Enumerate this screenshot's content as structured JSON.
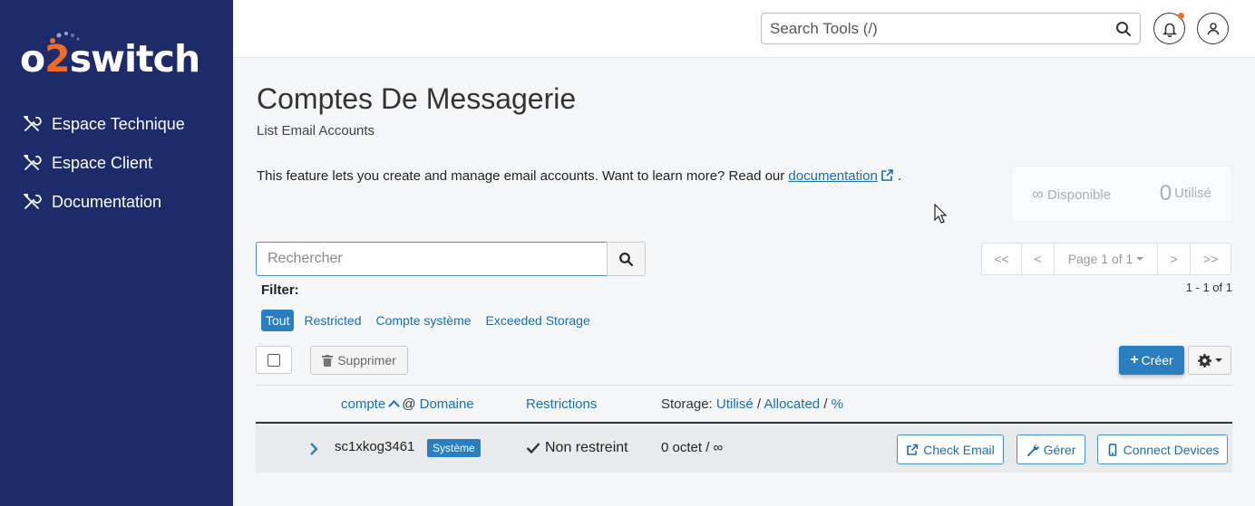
{
  "brand": {
    "logo_prefix": "o",
    "logo_two": "2",
    "logo_suffix": "switch"
  },
  "sidebar": {
    "items": [
      {
        "label": "Espace Technique",
        "icon": "tools-icon"
      },
      {
        "label": "Espace Client",
        "icon": "tools-icon"
      },
      {
        "label": "Documentation",
        "icon": "tools-icon"
      }
    ]
  },
  "topbar": {
    "search_placeholder": "Search Tools (/)",
    "icons": [
      "search-icon",
      "bell-icon",
      "user-icon"
    ]
  },
  "page": {
    "title": "Comptes De Messagerie",
    "subtitle": "List Email Accounts",
    "intro_text": "This feature lets you create and manage email accounts. Want to learn more? Read our ",
    "intro_link": "documentation",
    "intro_end": "."
  },
  "stats": {
    "available_symbol": "∞",
    "available_label": "Disponible",
    "used_value": "0",
    "used_label": "Utilisé"
  },
  "search": {
    "placeholder": "Rechercher"
  },
  "pager": {
    "first": "<<",
    "prev": "<",
    "page_label": "Page 1 of 1",
    "next": ">",
    "last": ">>",
    "range": "1 - 1 of 1"
  },
  "filter": {
    "label": "Filter:",
    "options": [
      "Tout",
      "Restricted",
      "Compte système",
      "Exceeded Storage"
    ],
    "active": "Tout"
  },
  "toolbar": {
    "delete_label": "Supprimer",
    "create_label": "Créer"
  },
  "table": {
    "headers": {
      "account": "compte",
      "at": "@",
      "domain": "Domaine",
      "restrictions": "Restrictions",
      "storage_prefix": "Storage:",
      "used": "Utilisé",
      "sep1": "/",
      "allocated": "Allocated",
      "sep2": "/",
      "percent": "%"
    },
    "rows": [
      {
        "account": "sc1xkog3461",
        "badge": "Système",
        "restriction": "Non restreint",
        "storage": "0 octet / ∞",
        "actions": [
          "Check Email",
          "Gérer",
          "Connect Devices"
        ]
      }
    ]
  },
  "colors": {
    "sidebar_bg": "#1e2b6b",
    "accent": "#2a7fc1",
    "link": "#1b6fad",
    "brand_orange": "#f26b21"
  }
}
